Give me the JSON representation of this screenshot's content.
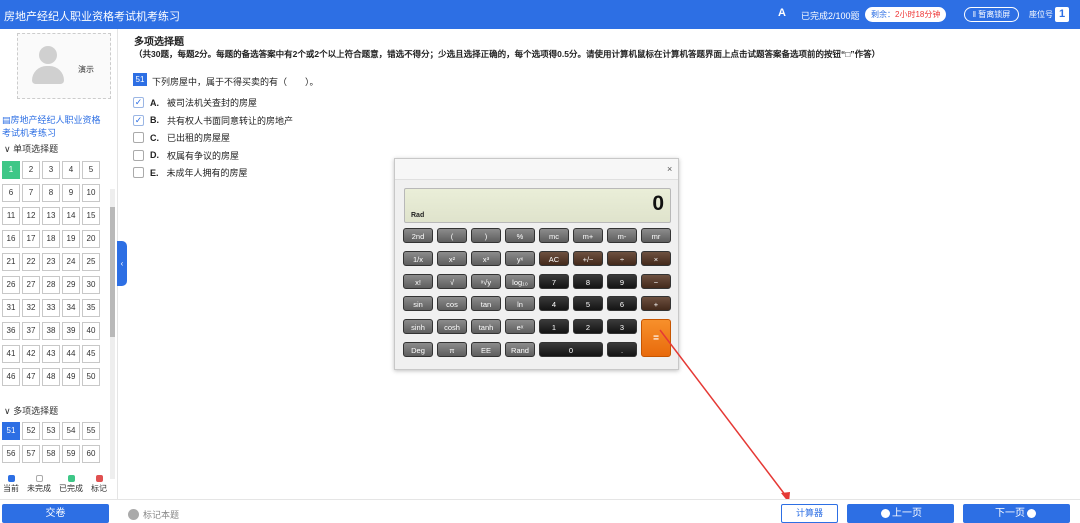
{
  "header": {
    "title": "房地产经纪人职业资格考试机考练习",
    "font_icon": "A",
    "progress": "已完成2/100题",
    "timer_label": "剩余：",
    "timer_value": "2小时18分钟",
    "pause_label": "‖ 暂离锁屏",
    "seat_label": "座位号",
    "seat_number": "1"
  },
  "sidebar": {
    "avatar_caption": "演示",
    "course_title": "房地产经纪人职业资格考试机考练习",
    "single_section": "单项选择题",
    "multi_section": "多项选择题",
    "single_questions": [
      "1",
      "2",
      "3",
      "4",
      "5",
      "6",
      "7",
      "8",
      "9",
      "10",
      "11",
      "12",
      "13",
      "14",
      "15",
      "16",
      "17",
      "18",
      "19",
      "20",
      "21",
      "22",
      "23",
      "24",
      "25",
      "26",
      "27",
      "28",
      "29",
      "30",
      "31",
      "32",
      "33",
      "34",
      "35",
      "36",
      "37",
      "38",
      "39",
      "40",
      "41",
      "42",
      "43",
      "44",
      "45",
      "46",
      "47",
      "48",
      "49",
      "50"
    ],
    "multi_questions": [
      "51",
      "52",
      "53",
      "54",
      "55",
      "56",
      "57",
      "58",
      "59",
      "60"
    ],
    "done_question": "1",
    "current_question": "51",
    "legend": [
      {
        "label": "当前",
        "color": "#2d6fe4"
      },
      {
        "label": "未完成",
        "color": "#ffffff"
      },
      {
        "label": "已完成",
        "color": "#3ec787"
      },
      {
        "label": "标记",
        "color": "#e05050"
      }
    ]
  },
  "question": {
    "section_title": "多项选择题",
    "section_desc": "（共30题，每题2分。每题的备选答案中有2个或2个以上符合题意，错选不得分；少选且选择正确的，每个选项得0.5分。请使用计算机鼠标在计算机答题界面上点击试题答案备选项前的按钮“□”作答）",
    "number": "51",
    "text": "下列房屋中，属于不得买卖的有（　　）。",
    "options": [
      {
        "letter": "A.",
        "text": "被司法机关查封的房屋",
        "checked": true
      },
      {
        "letter": "B.",
        "text": "共有权人书面同意转让的房地产",
        "checked": true
      },
      {
        "letter": "C.",
        "text": "已出租的房屋屋",
        "checked": false
      },
      {
        "letter": "D.",
        "text": "权属有争议的房屋",
        "checked": false
      },
      {
        "letter": "E.",
        "text": "未成年人拥有的房屋",
        "checked": false
      }
    ]
  },
  "calculator": {
    "close": "×",
    "display": "0",
    "mode": "Rad",
    "keys": [
      [
        "2nd",
        "(",
        ")",
        "%",
        "mc",
        "m+",
        "m-",
        "mr"
      ],
      [
        "1/x",
        "x²",
        "x³",
        "yˣ",
        "AC",
        "+/−",
        "÷",
        "×"
      ],
      [
        "x!",
        "√",
        "ˣ√y",
        "log₁₀",
        "7",
        "8",
        "9",
        "−"
      ],
      [
        "sin",
        "cos",
        "tan",
        "ln",
        "4",
        "5",
        "6",
        "+"
      ],
      [
        "sinh",
        "cosh",
        "tanh",
        "eˣ",
        "1",
        "2",
        "3"
      ],
      [
        "Deg",
        "π",
        "EE",
        "Rand",
        "0",
        "."
      ]
    ],
    "equals": "="
  },
  "footer": {
    "submit": "交卷",
    "mark": "标记本题",
    "calculator": "计算器",
    "prev": "上一页",
    "next": "下一页"
  },
  "colors": {
    "primary": "#2d6fe4",
    "done": "#3ec787",
    "arrow": "#e53935",
    "calc_orange": "#f07d1c"
  }
}
